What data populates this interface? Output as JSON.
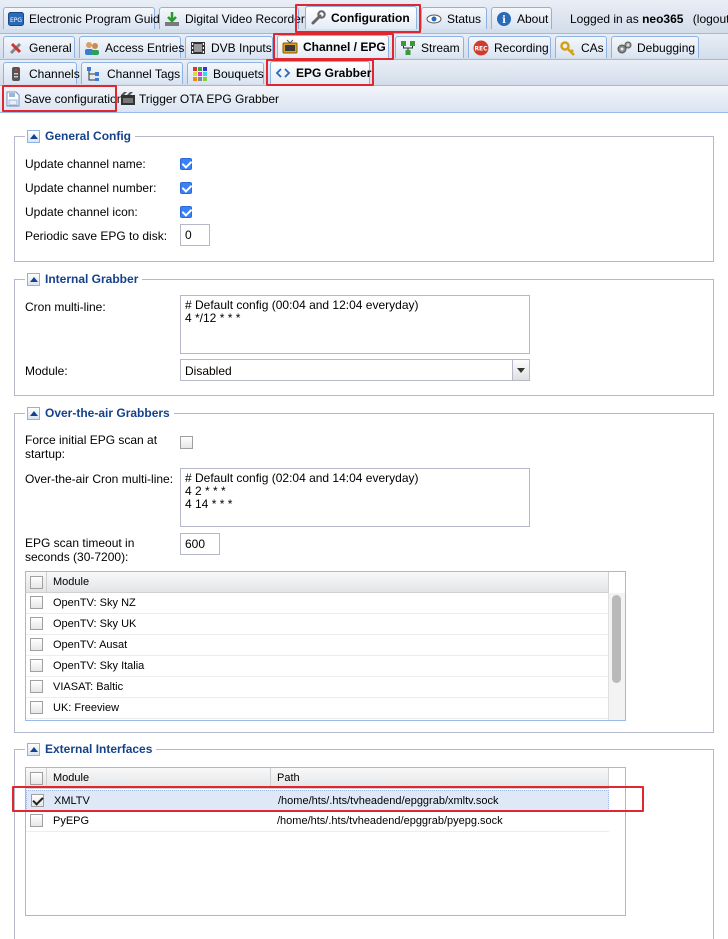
{
  "main_tabs": [
    {
      "label": "Electronic Program Guide",
      "icon": "epg-icon"
    },
    {
      "label": "Digital Video Recorder",
      "icon": "download-icon"
    },
    {
      "label": "Configuration",
      "icon": "wrench-icon"
    },
    {
      "label": "Status",
      "icon": "eye-icon"
    },
    {
      "label": "About",
      "icon": "info-icon"
    }
  ],
  "login": {
    "prefix": "Logged in as",
    "user": "neo365",
    "logout": "(logout)"
  },
  "config_tabs": [
    {
      "label": "General",
      "icon": "tools-icon"
    },
    {
      "label": "Access Entries",
      "icon": "users-icon"
    },
    {
      "label": "DVB Inputs",
      "icon": "film-icon"
    },
    {
      "label": "Channel / EPG",
      "icon": "tv-icon"
    },
    {
      "label": "Stream",
      "icon": "network-icon"
    },
    {
      "label": "Recording",
      "icon": "rec-icon"
    },
    {
      "label": "CAs",
      "icon": "key-icon"
    },
    {
      "label": "Debugging",
      "icon": "gears-icon"
    }
  ],
  "epg_tabs": [
    {
      "label": "Channels",
      "icon": "remote-icon"
    },
    {
      "label": "Channel Tags",
      "icon": "tree-icon"
    },
    {
      "label": "Bouquets",
      "icon": "grid-icon"
    },
    {
      "label": "EPG Grabber",
      "icon": "code-icon"
    }
  ],
  "toolbar": {
    "save": "Save configuration",
    "trigger": "Trigger OTA EPG Grabber"
  },
  "general": {
    "title": "General Config",
    "update_name": "Update channel name:",
    "update_number": "Update channel number:",
    "update_icon": "Update channel icon:",
    "periodic_save": "Periodic save EPG to disk:",
    "periodic_value": "0"
  },
  "internal": {
    "title": "Internal Grabber",
    "cron_label": "Cron multi-line:",
    "cron_lines": [
      "# Default config (00:04 and 12:04 everyday)",
      "4 */12 * * *"
    ],
    "module_label": "Module:",
    "module_value": "Disabled"
  },
  "ota": {
    "title": "Over-the-air Grabbers",
    "force_label_1": "Force initial EPG scan at",
    "force_label_2": "startup:",
    "cron_label": "Over-the-air Cron multi-line:",
    "cron_lines": [
      "# Default config (02:04 and 14:04 everyday)",
      "4 2 * * *",
      "4 14 * * *"
    ],
    "timeout_label_1": "EPG scan timeout in",
    "timeout_label_2": "seconds (30-7200):",
    "timeout_value": "600",
    "grid_header": "Module",
    "modules": [
      "OpenTV: Sky NZ",
      "OpenTV: Sky UK",
      "OpenTV: Ausat",
      "OpenTV: Sky Italia",
      "VIASAT: Baltic",
      "UK: Freeview"
    ]
  },
  "external": {
    "title": "External Interfaces",
    "col_module": "Module",
    "col_path": "Path",
    "rows": [
      {
        "module": "XMLTV",
        "path": "/home/hts/.hts/tvheadend/epggrab/xmltv.sock",
        "checked": true
      },
      {
        "module": "PyEPG",
        "path": "/home/hts/.hts/tvheadend/epggrab/pyepg.sock",
        "checked": false
      }
    ]
  },
  "colors": {
    "highlight": "#e0262f",
    "legend": "#15428b",
    "tab_border": "#8db2e3"
  }
}
